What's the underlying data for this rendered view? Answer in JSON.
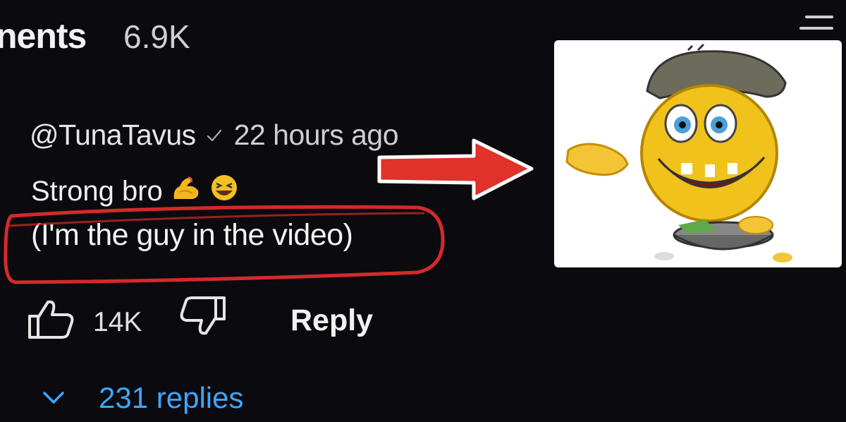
{
  "header": {
    "title": "nents",
    "count": "6.9K"
  },
  "comment": {
    "author": "@TunaTavus",
    "time": "22 hours ago",
    "text_line1": "Strong bro",
    "text_line2": "(I'm the guy in the video)",
    "likes": "14K",
    "reply_label": "Reply",
    "replies_label": "231 replies"
  },
  "icons": {
    "verified": "checkmark-icon",
    "like": "thumbs-up-icon",
    "dislike": "thumbs-down-icon",
    "expand": "chevron-down-icon",
    "menu": "hamburger-icon",
    "emoji1": "flexed-biceps-emoji",
    "emoji2": "laughing-emoji"
  },
  "colors": {
    "background": "#0b0a0f",
    "link": "#3ea6ff",
    "highlight": "#d42a2a",
    "arrow": "#e0312a"
  }
}
